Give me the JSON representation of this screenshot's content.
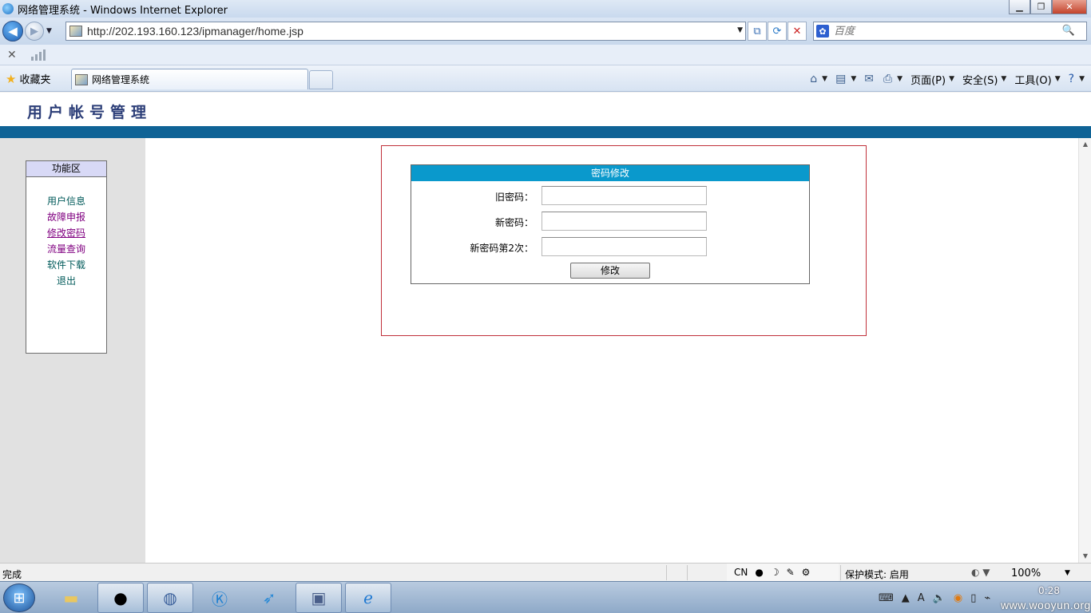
{
  "window": {
    "title": "网络管理系统 - Windows Internet Explorer",
    "minimize_glyph": "▁",
    "restore_glyph": "❐",
    "close_glyph": "✕"
  },
  "navigation": {
    "url": "http://202.193.160.123/ipmanager/home.jsp",
    "search_placeholder": "百度",
    "search_glyph": "🔍"
  },
  "favorites": {
    "label": "收藏夹"
  },
  "tab": {
    "label": "网络管理系统"
  },
  "command_bar": {
    "page": "页面(P)",
    "safety": "安全(S)",
    "tools": "工具(O)"
  },
  "page": {
    "title": "用户帐号管理",
    "sidebar": {
      "header": "功能区",
      "items": [
        {
          "label": "用户信息"
        },
        {
          "label": "故障申报"
        },
        {
          "label": "修改密码"
        },
        {
          "label": "流量查询"
        },
        {
          "label": "软件下载"
        },
        {
          "label": "退出"
        }
      ]
    },
    "password_form": {
      "header": "密码修改",
      "old_password_label": "旧密码：",
      "new_password_label": "新密码：",
      "confirm_password_label": "新密码第2次：",
      "submit_label": "修改"
    }
  },
  "status": {
    "text": "完成",
    "ime": "CN",
    "protected_mode": "保护模式: 启用",
    "zoom": "100%"
  },
  "taskbar": {
    "clock": "0:28",
    "watermark": "www.wooyun.org"
  }
}
